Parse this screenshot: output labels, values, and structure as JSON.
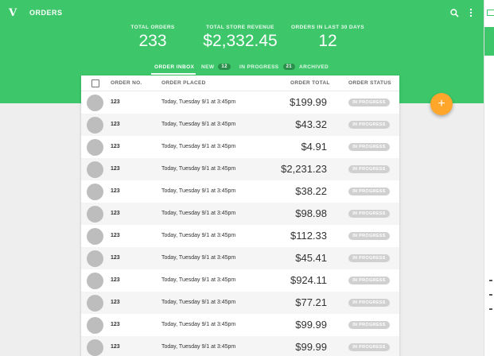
{
  "app": {
    "logo": "V",
    "title": "ORDERS"
  },
  "header_icons": {
    "search": "search-icon",
    "more": "more-vert-icon"
  },
  "stats": [
    {
      "label": "TOTAL ORDERS",
      "value": "233"
    },
    {
      "label": "TOTAL STORE REVENUE",
      "value": "$2,332.45"
    },
    {
      "label": "ORDERS IN LAST 30 DAYS",
      "value": "12"
    }
  ],
  "tabs": [
    {
      "label": "ORDER INBOX",
      "count": null,
      "active": true
    },
    {
      "label": "NEW",
      "count": "12",
      "active": false
    },
    {
      "label": "IN PROGRESS",
      "count": "21",
      "active": false
    },
    {
      "label": "ARCHIVED",
      "count": null,
      "active": false
    }
  ],
  "table": {
    "columns": [
      "ORDER NO.",
      "ORDER PLACED",
      "ORDER TOTAL",
      "ORDER STATUS"
    ],
    "rows": [
      {
        "order_no": "123",
        "placed": "Today, Tuesday 9/1 at 3:45pm",
        "total": "$199.99",
        "status": "IN PROGRESS"
      },
      {
        "order_no": "123",
        "placed": "Today, Tuesday 9/1 at 3:45pm",
        "total": "$43.32",
        "status": "IN PROGRESS"
      },
      {
        "order_no": "123",
        "placed": "Today, Tuesday 9/1 at 3:45pm",
        "total": "$4.91",
        "status": "IN PROGRESS"
      },
      {
        "order_no": "123",
        "placed": "Today, Tuesday 9/1 at 3:45pm",
        "total": "$2,231.23",
        "status": "IN PROGRESS"
      },
      {
        "order_no": "123",
        "placed": "Today, Tuesday 9/1 at 3:45pm",
        "total": "$38.22",
        "status": "IN PROGRESS"
      },
      {
        "order_no": "123",
        "placed": "Today, Tuesday 9/1 at 3:45pm",
        "total": "$98.98",
        "status": "IN PROGRESS"
      },
      {
        "order_no": "123",
        "placed": "Today, Tuesday 9/1 at 3:45pm",
        "total": "$112.33",
        "status": "IN PROGRESS"
      },
      {
        "order_no": "123",
        "placed": "Today, Tuesday 9/1 at 3:45pm",
        "total": "$45.41",
        "status": "IN PROGRESS"
      },
      {
        "order_no": "123",
        "placed": "Today, Tuesday 9/1 at 3:45pm",
        "total": "$924.11",
        "status": "IN PROGRESS"
      },
      {
        "order_no": "123",
        "placed": "Today, Tuesday 9/1 at 3:45pm",
        "total": "$77.21",
        "status": "IN PROGRESS"
      },
      {
        "order_no": "123",
        "placed": "Today, Tuesday 9/1 at 3:45pm",
        "total": "$99.99",
        "status": "IN PROGRESS"
      },
      {
        "order_no": "123",
        "placed": "Today, Tuesday 9/1 at 3:45pm",
        "total": "$99.99",
        "status": "IN PROGRESS"
      }
    ]
  },
  "fab": {
    "label": "+"
  },
  "colors": {
    "brand_green": "#3dc76a",
    "fab_orange": "#ffa62b",
    "status_grey": "#d0d0d0"
  }
}
